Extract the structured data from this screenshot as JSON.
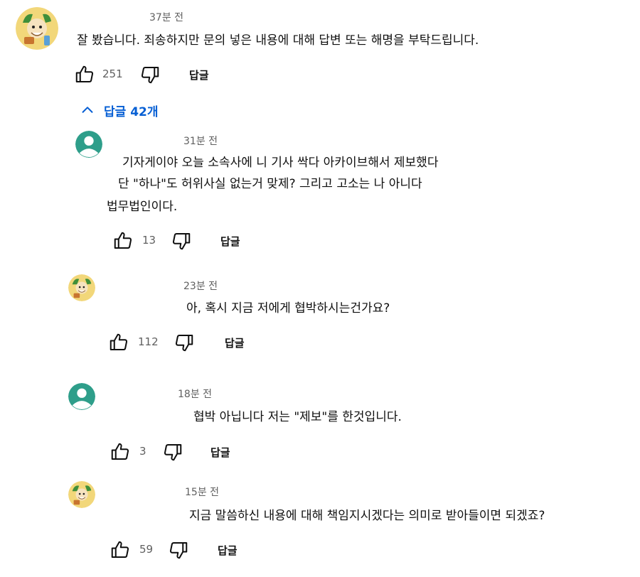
{
  "top_comment": {
    "time": "37분 전",
    "text": "잘 봤습니다. 죄송하지만 문의 넣은 내용에 대해 답변 또는 해명을 부탁드립니다.",
    "likes": "251",
    "reply_label": "답글",
    "avatar": "cartoon-avatar"
  },
  "replies_toggle": {
    "label": "답글 42개",
    "icon": "chevron-up-icon",
    "color": "#065fd4"
  },
  "replies": [
    {
      "time": "31분 전",
      "lines": [
        "기자게이야 오늘 소속사에 니 기사 싹다 아카이브해서 제보했다",
        "단 \"하나\"도 허위사실 없는거 맞제? 그리고 고소는 나 아니다",
        "법무법인이다."
      ],
      "likes": "13",
      "reply_label": "답글",
      "avatar": "default-user-avatar"
    },
    {
      "time": "23분 전",
      "lines": [
        "아, 혹시 지금 저에게 협박하시는건가요?"
      ],
      "likes": "112",
      "reply_label": "답글",
      "avatar": "cartoon-avatar"
    },
    {
      "time": "18분 전",
      "lines": [
        "협박 아닙니다 저는 \"제보\"를 한것입니다."
      ],
      "likes": "3",
      "reply_label": "답글",
      "avatar": "default-user-avatar"
    },
    {
      "time": "15분 전",
      "lines": [
        "지금 말씀하신 내용에 대해 책임지시겠다는 의미로 받아들이면 되겠죠?"
      ],
      "likes": "59",
      "reply_label": "답글",
      "avatar": "cartoon-avatar"
    }
  ],
  "colors": {
    "default_avatar": "#2e9e8a",
    "cartoon_bg": "#f2d77a",
    "link": "#065fd4"
  }
}
